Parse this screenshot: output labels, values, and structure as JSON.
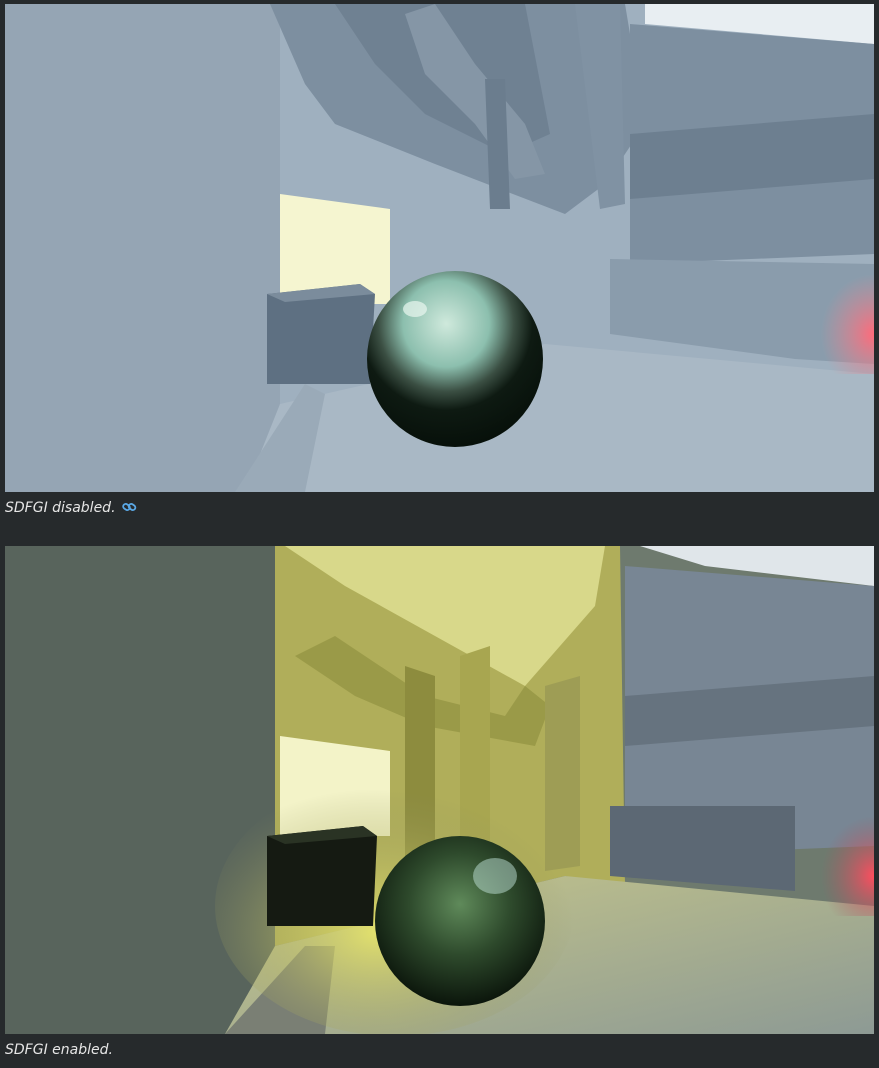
{
  "figures": [
    {
      "caption": "SDFGI disabled.",
      "icon": "link-icon"
    },
    {
      "caption": "SDFGI enabled."
    }
  ],
  "colors": {
    "page_background": "#262a2c",
    "caption_text": "#e6e6e6",
    "link_icon": "#5aa8e6"
  }
}
